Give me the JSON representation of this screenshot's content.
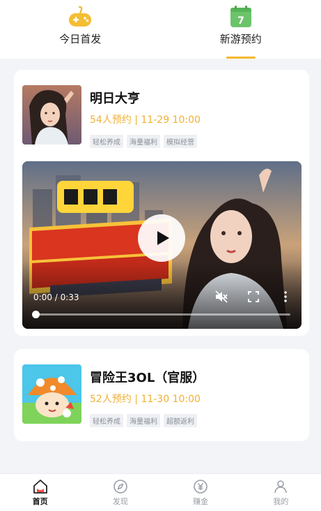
{
  "top_tabs": [
    {
      "label": "今日首发",
      "active": false,
      "icon": "gamepad-icon"
    },
    {
      "label": "新游预约",
      "active": true,
      "icon": "calendar-icon",
      "icon_text": "7"
    }
  ],
  "games": [
    {
      "title": "明日大亨",
      "meta": "54人预约 | 11-29 10:00",
      "tags": [
        "轻松养成",
        "海量福利",
        "模拟经营"
      ],
      "video": {
        "time": "0:00 / 0:33",
        "progress": 0
      }
    },
    {
      "title": "冒险王3OL（官服）",
      "meta": "52人预约 | 11-30 10:00",
      "tags": [
        "轻松养成",
        "海量福利",
        "超额返利"
      ]
    }
  ],
  "bottom_nav": [
    {
      "label": "首页",
      "active": true,
      "icon": "home-icon"
    },
    {
      "label": "发现",
      "active": false,
      "icon": "compass-icon"
    },
    {
      "label": "赚金",
      "active": false,
      "icon": "coin-icon"
    },
    {
      "label": "我的",
      "active": false,
      "icon": "user-icon"
    }
  ],
  "colors": {
    "accent": "#f1b033",
    "tab_underline": "#f5b82e",
    "calendar_green": "#6cc46a",
    "background": "#f3f4f8"
  }
}
